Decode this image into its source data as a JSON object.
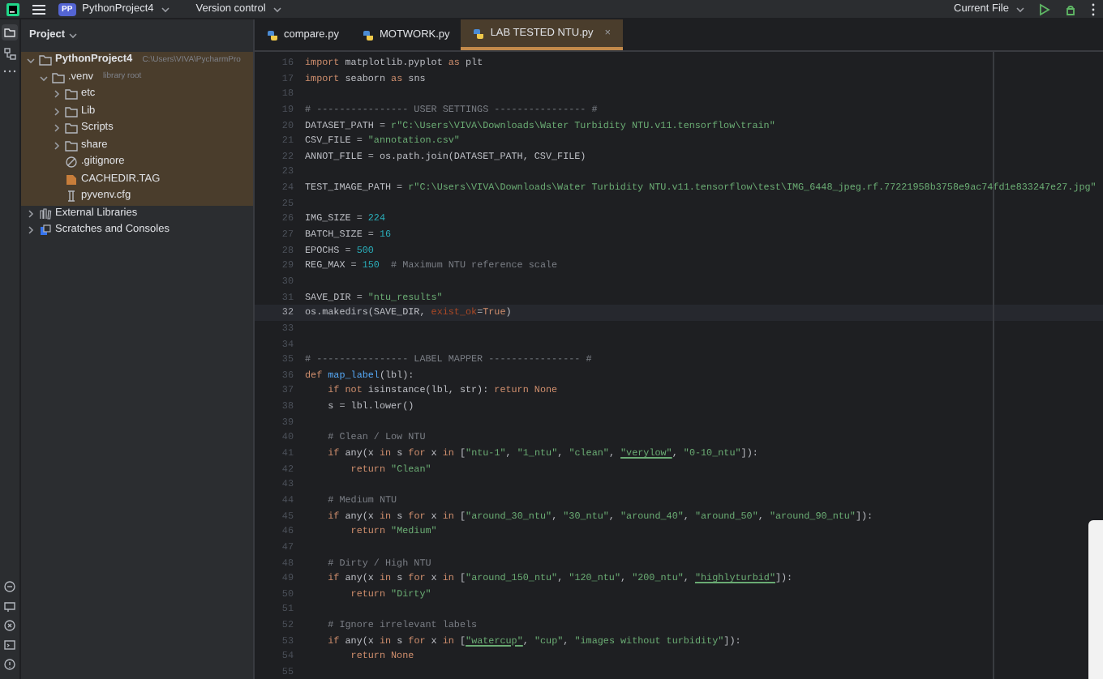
{
  "top_bar": {
    "project_badge": "PP",
    "project": "PythonProject4",
    "vcs": "Version control",
    "run_config": "Current File"
  },
  "project_panel": {
    "title": "Project",
    "tree": [
      {
        "label": "PythonProject4",
        "hint": "C:\\Users\\VIVA\\PycharmPro",
        "kind": "folder",
        "expanded": true,
        "children": [
          {
            "label": ".venv",
            "hint": "library root",
            "kind": "folder",
            "expanded": true,
            "children": [
              {
                "label": "etc",
                "kind": "folder",
                "expanded": false
              },
              {
                "label": "Lib",
                "kind": "folder",
                "expanded": false
              },
              {
                "label": "Scripts",
                "kind": "folder",
                "expanded": false
              },
              {
                "label": "share",
                "kind": "folder",
                "expanded": false
              },
              {
                "label": ".gitignore",
                "kind": "ignore"
              },
              {
                "label": "CACHEDIR.TAG",
                "kind": "tag"
              },
              {
                "label": "pyvenv.cfg",
                "kind": "config"
              }
            ]
          }
        ]
      },
      {
        "label": "External Libraries",
        "kind": "library",
        "expanded": false
      },
      {
        "label": "Scratches and Consoles",
        "kind": "scratch",
        "expanded": false
      }
    ]
  },
  "tabs": [
    {
      "label": "compare.py",
      "selected": false
    },
    {
      "label": "MOTWORK.py",
      "selected": false
    },
    {
      "label": "LAB TESTED NTU.py",
      "selected": true,
      "close": "×"
    }
  ],
  "editor": {
    "lines": [
      {
        "number": "16",
        "current": false,
        "tokens": [
          {
            "kind": "keyword",
            "text": "import"
          },
          {
            "kind": "plain",
            "text": " matplotlib.pyplot "
          },
          {
            "kind": "keyword",
            "text": "as"
          },
          {
            "kind": "plain",
            "text": " plt"
          }
        ]
      },
      {
        "number": "17",
        "current": false,
        "tokens": [
          {
            "kind": "keyword",
            "text": "import"
          },
          {
            "kind": "plain",
            "text": " seaborn "
          },
          {
            "kind": "keyword",
            "text": "as"
          },
          {
            "kind": "plain",
            "text": " sns"
          }
        ]
      },
      {
        "number": "18",
        "current": false
      },
      {
        "number": "19",
        "current": false,
        "tokens": [
          {
            "kind": "comment",
            "text": "# ---------------- USER SETTINGS ---------------- #"
          }
        ]
      },
      {
        "number": "20",
        "current": false,
        "tokens": [
          {
            "kind": "plain",
            "text": "DATASET_PATH = "
          },
          {
            "kind": "string",
            "text": "r\"C:\\Users\\VIVA\\Downloads\\Water Turbidity NTU.v11.tensorflow\\train\""
          }
        ]
      },
      {
        "number": "21",
        "current": false,
        "tokens": [
          {
            "kind": "plain",
            "text": "CSV_FILE = "
          },
          {
            "kind": "string",
            "text": "\"annotation.csv\""
          }
        ]
      },
      {
        "number": "22",
        "current": false,
        "tokens": [
          {
            "kind": "plain",
            "text": "ANNOT_FILE = os.path.join(DATASET_PATH, CSV_FILE)"
          }
        ]
      },
      {
        "number": "23",
        "current": false
      },
      {
        "number": "24",
        "current": false,
        "tokens": [
          {
            "kind": "plain",
            "text": "TEST_IMAGE_PATH = "
          },
          {
            "kind": "string",
            "text": "r\"C:\\Users\\VIVA\\Downloads\\Water Turbidity NTU.v11.tensorflow\\test\\IMG_6448_jpeg.rf.77221958b3758e9ac74fd1e833247e27.jpg\""
          }
        ]
      },
      {
        "number": "25",
        "current": false
      },
      {
        "number": "26",
        "current": false,
        "tokens": [
          {
            "kind": "plain",
            "text": "IMG_SIZE = "
          },
          {
            "kind": "number",
            "text": "224"
          }
        ]
      },
      {
        "number": "27",
        "current": false,
        "tokens": [
          {
            "kind": "plain",
            "text": "BATCH_SIZE = "
          },
          {
            "kind": "number",
            "text": "16"
          }
        ]
      },
      {
        "number": "28",
        "current": false,
        "tokens": [
          {
            "kind": "plain",
            "text": "EPOCHS = "
          },
          {
            "kind": "number",
            "text": "500"
          }
        ]
      },
      {
        "number": "29",
        "current": false,
        "tokens": [
          {
            "kind": "plain",
            "text": "REG_MAX = "
          },
          {
            "kind": "number",
            "text": "150"
          },
          {
            "kind": "comment",
            "text": "  # Maximum NTU reference scale"
          }
        ]
      },
      {
        "number": "30",
        "current": false
      },
      {
        "number": "31",
        "current": false,
        "tokens": [
          {
            "kind": "plain",
            "text": "SAVE_DIR = "
          },
          {
            "kind": "string",
            "text": "\"ntu_results\""
          }
        ]
      },
      {
        "number": "32",
        "current": true,
        "tokens": [
          {
            "kind": "plain",
            "text": "os.makedirs(SAVE_DIR, "
          },
          {
            "kind": "param",
            "text": "exist_ok"
          },
          {
            "kind": "plain",
            "text": "="
          },
          {
            "kind": "keyword",
            "text": "True"
          },
          {
            "kind": "plain",
            "text": ")"
          }
        ]
      },
      {
        "number": "33",
        "current": false
      },
      {
        "number": "34",
        "current": false
      },
      {
        "number": "35",
        "current": false,
        "tokens": [
          {
            "kind": "comment",
            "text": "# ---------------- LABEL MAPPER ---------------- #"
          }
        ]
      },
      {
        "number": "36",
        "current": false,
        "tokens": [
          {
            "kind": "keyword",
            "text": "def "
          },
          {
            "kind": "function",
            "text": "map_label"
          },
          {
            "kind": "plain",
            "text": "(lbl):"
          }
        ]
      },
      {
        "number": "37",
        "current": false,
        "tokens": [
          {
            "kind": "keyword",
            "text": "    if not"
          },
          {
            "kind": "plain",
            "text": " isinstance(lbl, str): "
          },
          {
            "kind": "keyword",
            "text": "return None"
          }
        ]
      },
      {
        "number": "38",
        "current": false,
        "tokens": [
          {
            "kind": "plain",
            "text": "    s = lbl.lower()"
          }
        ]
      },
      {
        "number": "39",
        "current": false
      },
      {
        "number": "40",
        "current": false,
        "tokens": [
          {
            "kind": "comment",
            "text": "    # Clean / Low NTU"
          }
        ]
      },
      {
        "number": "41",
        "current": false,
        "tokens": [
          {
            "kind": "keyword",
            "text": "    if"
          },
          {
            "kind": "plain",
            "text": " any(x "
          },
          {
            "kind": "keyword",
            "text": "in"
          },
          {
            "kind": "plain",
            "text": " s "
          },
          {
            "kind": "keyword",
            "text": "for"
          },
          {
            "kind": "plain",
            "text": " x "
          },
          {
            "kind": "keyword",
            "text": "in"
          },
          {
            "kind": "plain",
            "text": " ["
          },
          {
            "kind": "string",
            "text": "\"ntu-1\""
          },
          {
            "kind": "plain",
            "text": ", "
          },
          {
            "kind": "string",
            "text": "\"1_ntu\""
          },
          {
            "kind": "plain",
            "text": ", "
          },
          {
            "kind": "string",
            "text": "\"clean\""
          },
          {
            "kind": "plain",
            "text": ", "
          },
          {
            "kind": "typo",
            "text": "\"verylow\""
          },
          {
            "kind": "plain",
            "text": ", "
          },
          {
            "kind": "string",
            "text": "\"0-10_ntu\""
          },
          {
            "kind": "plain",
            "text": "]):"
          }
        ]
      },
      {
        "number": "42",
        "current": false,
        "tokens": [
          {
            "kind": "keyword",
            "text": "        return"
          },
          {
            "kind": "string",
            "text": " \"Clean\""
          }
        ]
      },
      {
        "number": "43",
        "current": false
      },
      {
        "number": "44",
        "current": false,
        "tokens": [
          {
            "kind": "comment",
            "text": "    # Medium NTU"
          }
        ]
      },
      {
        "number": "45",
        "current": false,
        "tokens": [
          {
            "kind": "keyword",
            "text": "    if"
          },
          {
            "kind": "plain",
            "text": " any(x "
          },
          {
            "kind": "keyword",
            "text": "in"
          },
          {
            "kind": "plain",
            "text": " s "
          },
          {
            "kind": "keyword",
            "text": "for"
          },
          {
            "kind": "plain",
            "text": " x "
          },
          {
            "kind": "keyword",
            "text": "in"
          },
          {
            "kind": "plain",
            "text": " ["
          },
          {
            "kind": "string",
            "text": "\"around_30_ntu\""
          },
          {
            "kind": "plain",
            "text": ", "
          },
          {
            "kind": "string",
            "text": "\"30_ntu\""
          },
          {
            "kind": "plain",
            "text": ", "
          },
          {
            "kind": "string",
            "text": "\"around_40\""
          },
          {
            "kind": "plain",
            "text": ", "
          },
          {
            "kind": "string",
            "text": "\"around_50\""
          },
          {
            "kind": "plain",
            "text": ", "
          },
          {
            "kind": "string",
            "text": "\"around_90_ntu\""
          },
          {
            "kind": "plain",
            "text": "]):"
          }
        ]
      },
      {
        "number": "46",
        "current": false,
        "tokens": [
          {
            "kind": "keyword",
            "text": "        return"
          },
          {
            "kind": "string",
            "text": " \"Medium\""
          }
        ]
      },
      {
        "number": "47",
        "current": false
      },
      {
        "number": "48",
        "current": false,
        "tokens": [
          {
            "kind": "comment",
            "text": "    # Dirty / High NTU"
          }
        ]
      },
      {
        "number": "49",
        "current": false,
        "tokens": [
          {
            "kind": "keyword",
            "text": "    if"
          },
          {
            "kind": "plain",
            "text": " any(x "
          },
          {
            "kind": "keyword",
            "text": "in"
          },
          {
            "kind": "plain",
            "text": " s "
          },
          {
            "kind": "keyword",
            "text": "for"
          },
          {
            "kind": "plain",
            "text": " x "
          },
          {
            "kind": "keyword",
            "text": "in"
          },
          {
            "kind": "plain",
            "text": " ["
          },
          {
            "kind": "string",
            "text": "\"around_150_ntu\""
          },
          {
            "kind": "plain",
            "text": ", "
          },
          {
            "kind": "string",
            "text": "\"120_ntu\""
          },
          {
            "kind": "plain",
            "text": ", "
          },
          {
            "kind": "string",
            "text": "\"200_ntu\""
          },
          {
            "kind": "plain",
            "text": ", "
          },
          {
            "kind": "typo",
            "text": "\"highlyturbid\""
          },
          {
            "kind": "plain",
            "text": "]):"
          }
        ]
      },
      {
        "number": "50",
        "current": false,
        "tokens": [
          {
            "kind": "keyword",
            "text": "        return"
          },
          {
            "kind": "string",
            "text": " \"Dirty\""
          }
        ]
      },
      {
        "number": "51",
        "current": false
      },
      {
        "number": "52",
        "current": false,
        "tokens": [
          {
            "kind": "comment",
            "text": "    # Ignore irrelevant labels"
          }
        ]
      },
      {
        "number": "53",
        "current": false,
        "tokens": [
          {
            "kind": "keyword",
            "text": "    if"
          },
          {
            "kind": "plain",
            "text": " any(x "
          },
          {
            "kind": "keyword",
            "text": "in"
          },
          {
            "kind": "plain",
            "text": " s "
          },
          {
            "kind": "keyword",
            "text": "for"
          },
          {
            "kind": "plain",
            "text": " x "
          },
          {
            "kind": "keyword",
            "text": "in"
          },
          {
            "kind": "plain",
            "text": " ["
          },
          {
            "kind": "typo",
            "text": "\"watercup\""
          },
          {
            "kind": "plain",
            "text": ", "
          },
          {
            "kind": "string",
            "text": "\"cup\""
          },
          {
            "kind": "plain",
            "text": ", "
          },
          {
            "kind": "string",
            "text": "\"images without turbidity\""
          },
          {
            "kind": "plain",
            "text": "]):"
          }
        ]
      },
      {
        "number": "54",
        "current": false,
        "tokens": [
          {
            "kind": "keyword",
            "text": "        return None"
          }
        ]
      },
      {
        "number": "55",
        "current": false
      }
    ]
  }
}
